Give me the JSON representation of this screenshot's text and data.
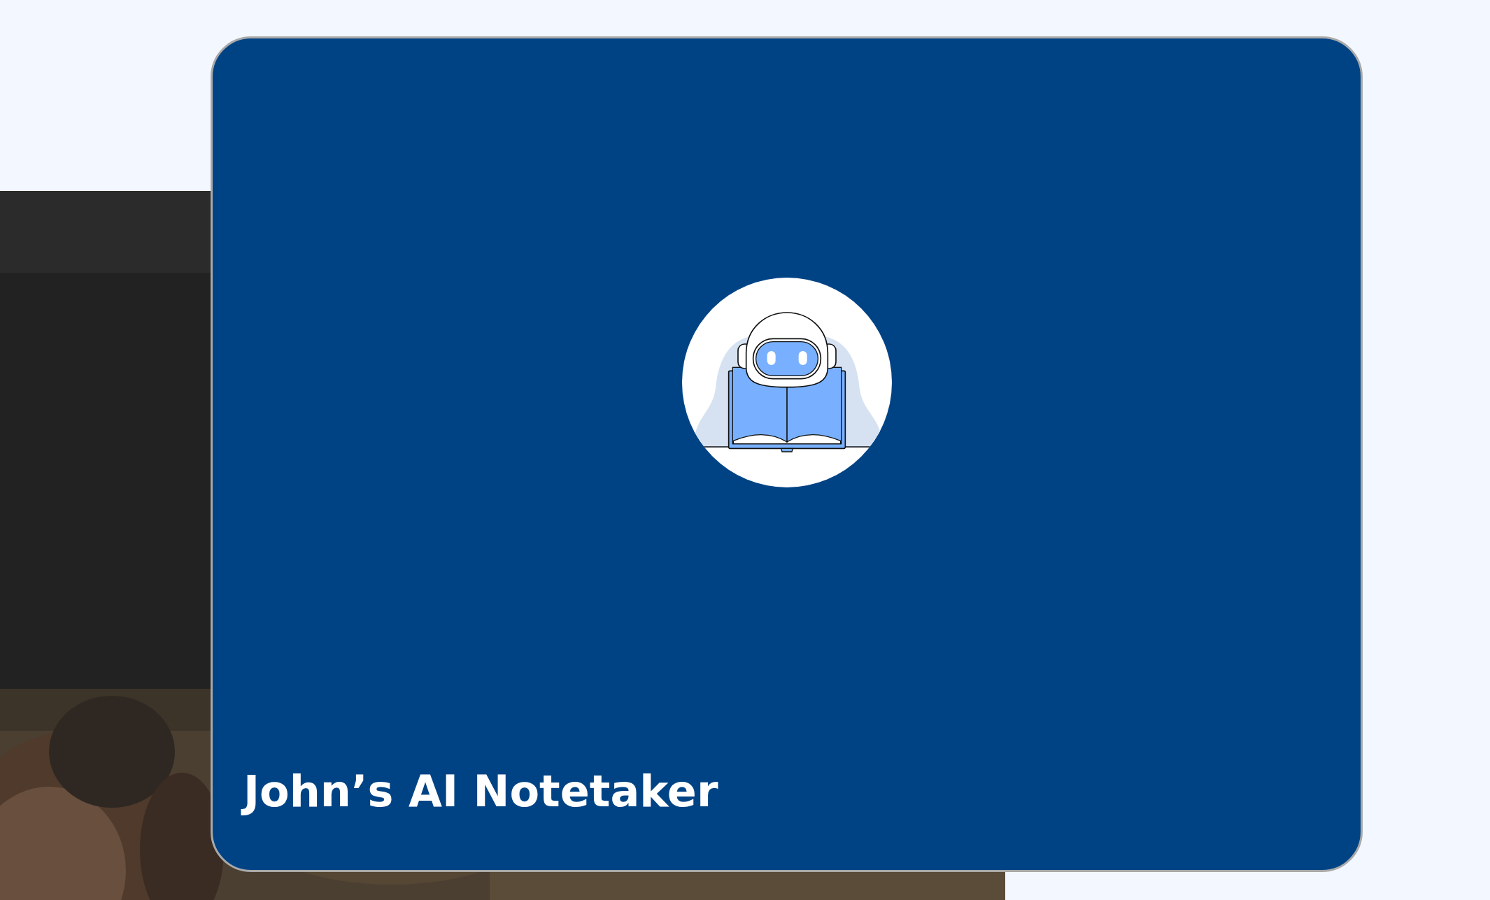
{
  "card": {
    "title": "John’s AI Notetaker"
  }
}
